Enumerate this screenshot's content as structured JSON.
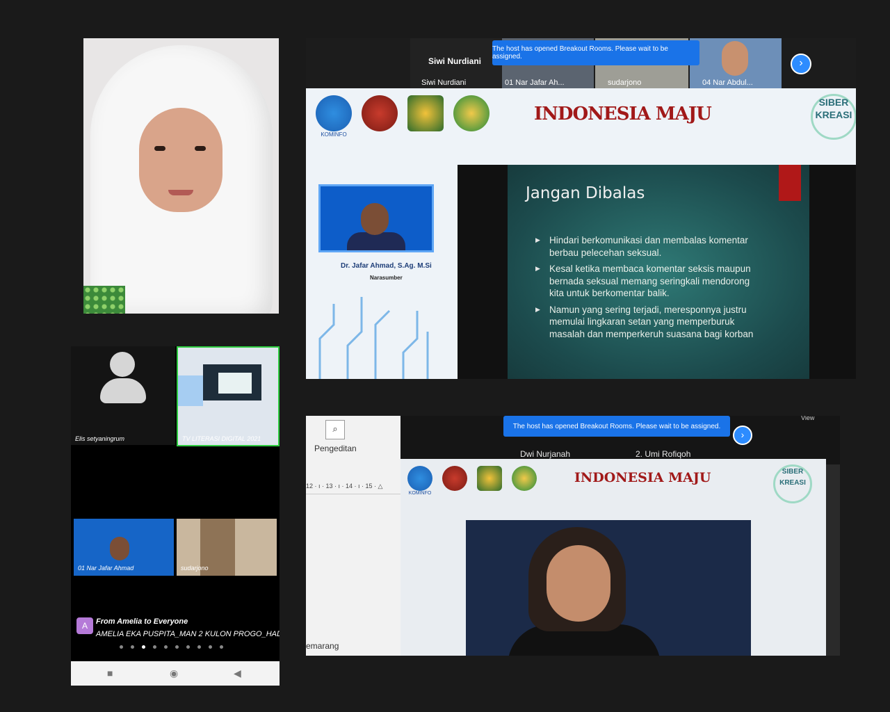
{
  "main_meeting": {
    "speaker_name": "Siwi Nurdiani",
    "thumbnails": [
      {
        "label": "Siwi Nurdiani"
      },
      {
        "label": "01 Nar Jafar Ah..."
      },
      {
        "label": "sudarjono"
      },
      {
        "label": "04 Nar Abdul..."
      }
    ],
    "notification": "The host has opened Breakout Rooms. Please wait to be assigned.",
    "logos": [
      "KOMINFO"
    ],
    "brand_text": "INDONESIA MAJU",
    "siber_text": "SIBER KREASI",
    "slide": {
      "title": "Jangan Dibalas",
      "bullets": [
        "Hindari berkomunikasi dan membalas komentar berbau pelecehan seksual.",
        "Kesal ketika membaca komentar seksis maupun bernada seksual memang seringkali mendorong kita untuk berkomentar balik.",
        "Namun yang sering terjadi, meresponnya justru memulai lingkaran setan yang memperburuk masalah dan memperkeruh suasana bagi korban"
      ]
    },
    "presenter_name": "Dr. Jafar Ahmad, S.Ag. M.Si",
    "presenter_role": "Narasumber"
  },
  "phone": {
    "tiles": [
      {
        "label": "Elis setyaningrum"
      },
      {
        "label": "TV LITERASI DIGITAL 2021"
      },
      {
        "label": "01 Nar Jafar Ahmad"
      },
      {
        "label": "sudarjono"
      }
    ],
    "chat": {
      "avatar": "A",
      "from": "From Amelia to Everyone",
      "message": "AMELIA EKA PUSPITA_MAN 2 KULON PROGO_HADIR"
    },
    "nav": {
      "square": "■",
      "circle": "◉",
      "back": "◀"
    }
  },
  "laptop": {
    "search_icon": "⌕",
    "pane_label": "Pengeditan",
    "ruler": "12 · ı · 13 · ı · 14 · ı · 15 · △",
    "location": "emarang",
    "notification": "The host has opened Breakout Rooms. Please wait to be assigned.",
    "view_label": "View",
    "names": [
      "Dwi Nurjanah",
      "2. Umi Rofiqoh"
    ],
    "logos": [
      "KOMINFO"
    ],
    "brand_text": "INDONESIA MAJU",
    "siber_text": "SIBER KREASI"
  }
}
